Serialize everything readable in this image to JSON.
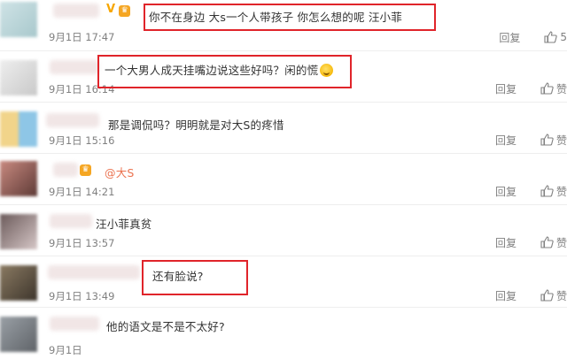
{
  "labels": {
    "reply": "回复",
    "like": "赞"
  },
  "comments": [
    {
      "text": "你不在身边 大s一个人带孩子 你怎么想的呢 汪小菲",
      "mention": "",
      "time": "9月1日 17:47",
      "likes": "5",
      "avatar_colors": [
        "#cfe3e6",
        "#a8c8cc"
      ],
      "badges": [
        "V",
        "crown"
      ]
    },
    {
      "text": "一个大男人成天挂嘴边说这些好吗？闲的慌",
      "mention": "",
      "time": "9月1日 16:14",
      "likes": "",
      "avatar_colors": [
        "#e6e6e6",
        "#c9c9c9"
      ],
      "badges": []
    },
    {
      "text": "那是调侃吗？明明就是对大S的疼惜",
      "mention": "",
      "time": "9月1日 15:16",
      "likes": "",
      "avatar_colors": [
        "#f1d48a",
        "#8ec6e6"
      ],
      "badges": []
    },
    {
      "text": "",
      "mention": "@大S",
      "time": "9月1日 14:21",
      "likes": "",
      "avatar_colors": [
        "#b9736b",
        "#5e3a36"
      ],
      "badges": [
        "crown"
      ]
    },
    {
      "text": "汪小菲真贫",
      "mention": "",
      "time": "9月1日 13:57",
      "likes": "",
      "avatar_colors": [
        "#6b5a5a",
        "#d6c7c7"
      ],
      "badges": []
    },
    {
      "text": "还有脸说?",
      "mention": "",
      "time": "9月1日 13:49",
      "likes": "",
      "avatar_colors": [
        "#7a6a55",
        "#3d352c"
      ],
      "badges": []
    },
    {
      "text": "他的语文是不是不太好?",
      "mention": "",
      "time": "9月1日",
      "likes": "",
      "avatar_colors": [
        "#9aa0a6",
        "#5f6368"
      ],
      "badges": []
    }
  ]
}
